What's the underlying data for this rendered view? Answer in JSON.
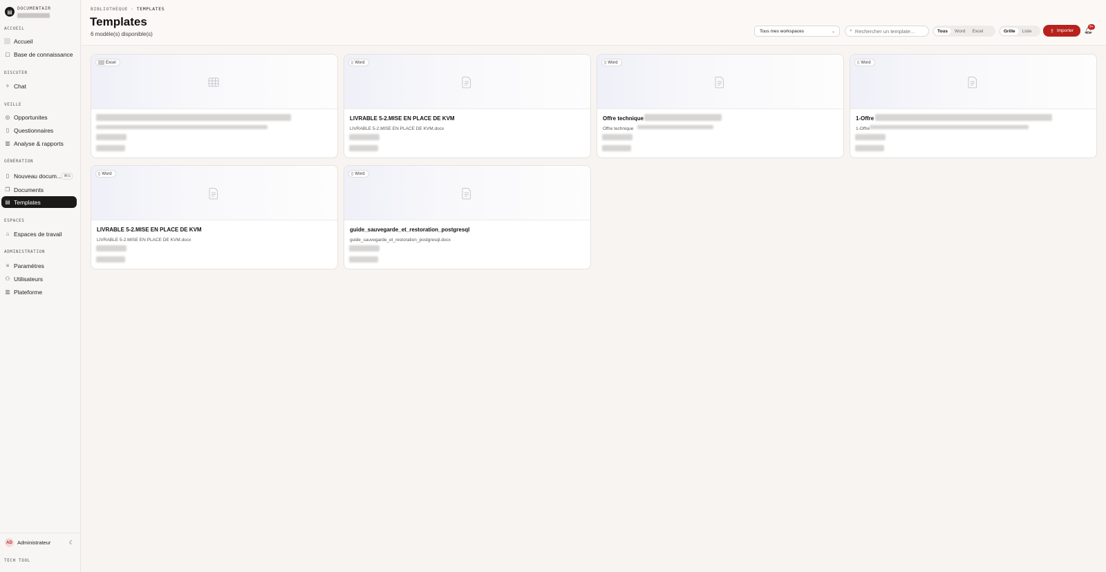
{
  "sidebar": {
    "brand": "DOCUMENTAIR",
    "sections": {
      "accueil": "ACCUEIL",
      "discuter": "DISCUTER",
      "veille": "VEILLE",
      "generation": "GÉNÉRATION",
      "espaces": "ESPACES",
      "administration": "ADMINISTRATION"
    },
    "items": {
      "accueil": "Accueil",
      "base": "Base de connaissance",
      "chat": "Chat",
      "opportunites": "Opportunites",
      "questionnaires": "Questionnaires",
      "analyse": "Analyse & rapports",
      "nouveau": "Nouveau docum...",
      "nouveau_kbd": "⌘G",
      "documents": "Documents",
      "templates": "Templates",
      "espaces_travail": "Espaces de travail",
      "parametres": "Paramètres",
      "utilisateurs": "Utilisateurs",
      "plateforme": "Plateforme"
    },
    "user": {
      "initials": "AD",
      "name": "Administrateur"
    },
    "footer": "TECH TOOL"
  },
  "header": {
    "breadcrumb": [
      "BIBLIOTHÈQUE",
      "TEMPLATES"
    ],
    "title": "Templates",
    "subtitle": "6 modèle(s) disponible(s)",
    "workspace_select": "Tous mes workspaces",
    "search_placeholder": "Rechercher un template...",
    "filters": [
      "Tous",
      "Word",
      "Excel"
    ],
    "active_filter": "Tous",
    "views": [
      "Grille",
      "Liste"
    ],
    "active_view": "Grille",
    "import_label": "Importer",
    "notif_badge": "9+",
    "accent_color": "#b8221d"
  },
  "templates": [
    {
      "type": "Excel",
      "title": "",
      "file": ""
    },
    {
      "type": "Word",
      "title": "LIVRABLE 5-2.MISE EN PLACE DE KVM",
      "file": "LIVRABLE 5-2.MISE EN PLACE DE KVM.docx"
    },
    {
      "type": "Word",
      "title": "Offre technique",
      "file": "Offre technique"
    },
    {
      "type": "Word",
      "title": "1-Offre",
      "file": "1-Offre"
    },
    {
      "type": "Word",
      "title": "LIVRABLE 5-2.MISE EN PLACE DE KVM",
      "file": "LIVRABLE 5-2.MISE EN PLACE DE KVM.docx"
    },
    {
      "type": "Word",
      "title": "guide_sauvegarde_et_restoration_postgresql",
      "file": "guide_sauvegarde_et_restoration_postgresql.docx"
    }
  ]
}
